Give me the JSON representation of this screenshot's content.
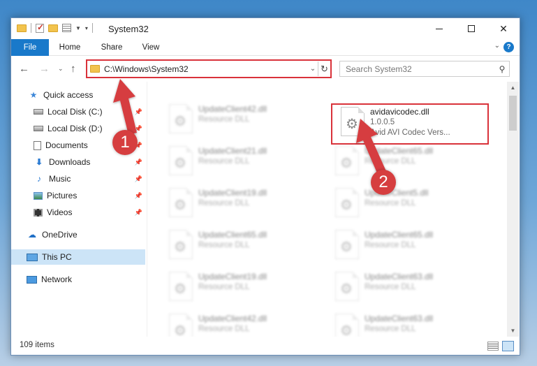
{
  "window": {
    "title": "System32"
  },
  "ribbon": {
    "tabs": [
      "File",
      "Home",
      "Share",
      "View"
    ],
    "help_label": "?"
  },
  "address_bar": {
    "path": "C:\\Windows\\System32"
  },
  "search": {
    "placeholder": "Search System32"
  },
  "sidebar": {
    "items": [
      {
        "label": "Quick access",
        "icon": "star-icon",
        "pinned": false
      },
      {
        "label": "Local Disk (C:)",
        "icon": "disk-icon",
        "pinned": true
      },
      {
        "label": "Local Disk (D:)",
        "icon": "disk-icon",
        "pinned": true
      },
      {
        "label": "Documents",
        "icon": "documents-icon",
        "pinned": true
      },
      {
        "label": "Downloads",
        "icon": "downloads-icon",
        "pinned": true
      },
      {
        "label": "Music",
        "icon": "music-icon",
        "pinned": true
      },
      {
        "label": "Pictures",
        "icon": "pictures-icon",
        "pinned": true
      },
      {
        "label": "Videos",
        "icon": "videos-icon",
        "pinned": true
      },
      {
        "label": "OneDrive",
        "icon": "onedrive-icon",
        "pinned": false
      },
      {
        "label": "This PC",
        "icon": "this-pc-icon",
        "pinned": false,
        "selected": true
      },
      {
        "label": "Network",
        "icon": "network-icon",
        "pinned": false
      }
    ]
  },
  "files": {
    "highlighted": {
      "name": "avidavicodec.dll",
      "version": "1.0.0.5",
      "description": "Avid AVI Codec Vers..."
    },
    "left_column": [
      {
        "name": "UpdateClient42.dll",
        "type": "Resource DLL"
      },
      {
        "name": "UpdateClient21.dll",
        "type": "Resource DLL"
      },
      {
        "name": "UpdateClient19.dll",
        "type": "Resource DLL"
      },
      {
        "name": "UpdateClient65.dll",
        "type": "Resource DLL"
      },
      {
        "name": "UpdateClient19.dll",
        "type": "Resource DLL"
      },
      {
        "name": "UpdateClient42.dll",
        "type": "Resource DLL"
      }
    ],
    "right_column": [
      {
        "name": "UpdateClient65.dll",
        "type": "Resource DLL"
      },
      {
        "name": "UpdateClient5.dll",
        "type": "Resource DLL"
      },
      {
        "name": "UpdateClient65.dll",
        "type": "Resource DLL"
      },
      {
        "name": "UpdateClient63.dll",
        "type": "Resource DLL"
      },
      {
        "name": "UpdateClient63.dll",
        "type": "Resource DLL"
      }
    ]
  },
  "status": {
    "item_count": "109 items"
  },
  "annotations": {
    "step1": "1",
    "step2": "2",
    "color": "#d63e3f"
  },
  "colors": {
    "accent": "#1979ca",
    "highlight_border": "#d9323a",
    "selected_bg": "#cce4f7"
  }
}
